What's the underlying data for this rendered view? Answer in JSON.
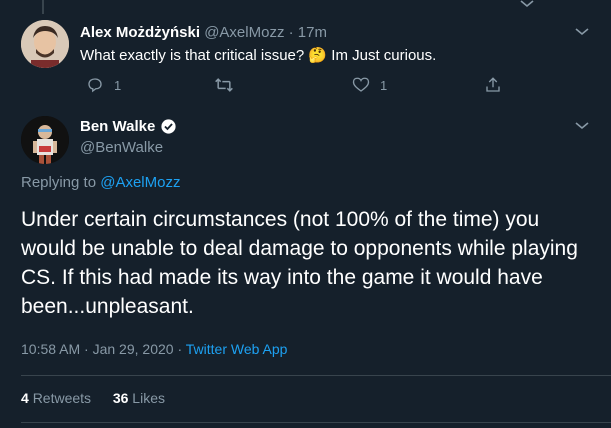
{
  "reply_tweet": {
    "name": "Alex Możdżyński",
    "handle": "@AxelMozz",
    "separator": "·",
    "time": "17m",
    "text_before_emoji": "What exactly is that critical issue?",
    "emoji": "🤔",
    "text_after_emoji": "Im Just curious.",
    "reply_count": "1",
    "like_count": "1",
    "icons": [
      "reply-icon",
      "retweet-icon",
      "like-icon",
      "share-icon",
      "chevron-down-icon"
    ]
  },
  "main_tweet": {
    "name": "Ben Walke",
    "handle": "@BenWalke",
    "verified": true,
    "replying_prefix": "Replying to",
    "replying_to": "@AxelMozz",
    "text": "Under certain circumstances (not 100% of the time) you would be unable to deal damage to opponents while playing CS. If this had made its way into the game it would have been...unpleasant.",
    "timestamp": "10:58 AM · Jan 29, 2020",
    "timestamp_sep": "·",
    "source": "Twitter Web App",
    "retweets_count": "4",
    "retweets_label": "Retweets",
    "likes_count": "36",
    "likes_label": "Likes"
  },
  "colors": {
    "background": "#15202b",
    "accent": "#1da1f2",
    "muted": "#8899a6",
    "divider": "#38444d"
  }
}
